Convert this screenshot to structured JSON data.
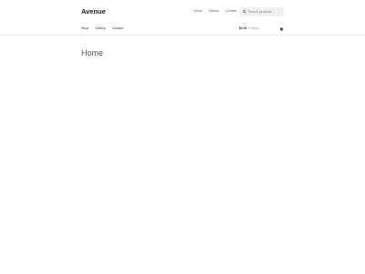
{
  "site": {
    "title": "Avenue"
  },
  "secondary_nav": [
    "Home",
    "Gallery",
    "Contact"
  ],
  "search": {
    "placeholder": "Search products..."
  },
  "primary_nav": [
    "Shop",
    "Gallery",
    "Contact"
  ],
  "cart": {
    "total": "$0.00",
    "count": "0 items"
  },
  "page": {
    "heading": "Home"
  },
  "icons": {
    "search": "search-icon",
    "cart": "cart-icon"
  },
  "colors": {
    "background": "#ffffff",
    "search_bg": "#f1f1f1",
    "text": "#333333"
  }
}
